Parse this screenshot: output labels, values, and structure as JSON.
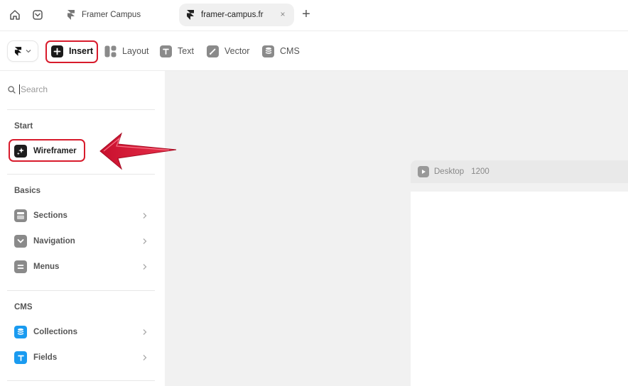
{
  "tabbar": {
    "inactive_tab": "Framer Campus",
    "active_tab": "framer-campus.fr",
    "close_glyph": "×",
    "new_tab_glyph": "+"
  },
  "toolbar": {
    "tools": [
      {
        "label": "Insert",
        "icon": "plus-square-icon"
      },
      {
        "label": "Layout",
        "icon": "layout-icon"
      },
      {
        "label": "Text",
        "icon": "text-icon"
      },
      {
        "label": "Vector",
        "icon": "pen-icon"
      },
      {
        "label": "CMS",
        "icon": "database-icon"
      }
    ]
  },
  "sidebar": {
    "search_placeholder": "Search",
    "sections": [
      {
        "title": "Start",
        "items": [
          {
            "label": "Wireframer",
            "icon": "sparkle-icon"
          }
        ]
      },
      {
        "title": "Basics",
        "items": [
          {
            "label": "Sections",
            "icon": "sections-icon"
          },
          {
            "label": "Navigation",
            "icon": "chevron-down-icon"
          },
          {
            "label": "Menus",
            "icon": "menu-icon"
          }
        ]
      },
      {
        "title": "CMS",
        "items": [
          {
            "label": "Collections",
            "icon": "database-icon"
          },
          {
            "label": "Fields",
            "icon": "text-icon"
          }
        ]
      }
    ]
  },
  "canvas": {
    "frame_name": "Desktop",
    "frame_width": "1200"
  },
  "colors": {
    "annotation_red": "#d81b2c",
    "cms_blue": "#1a9bf0",
    "canvas_bg": "#f1f1f1"
  }
}
